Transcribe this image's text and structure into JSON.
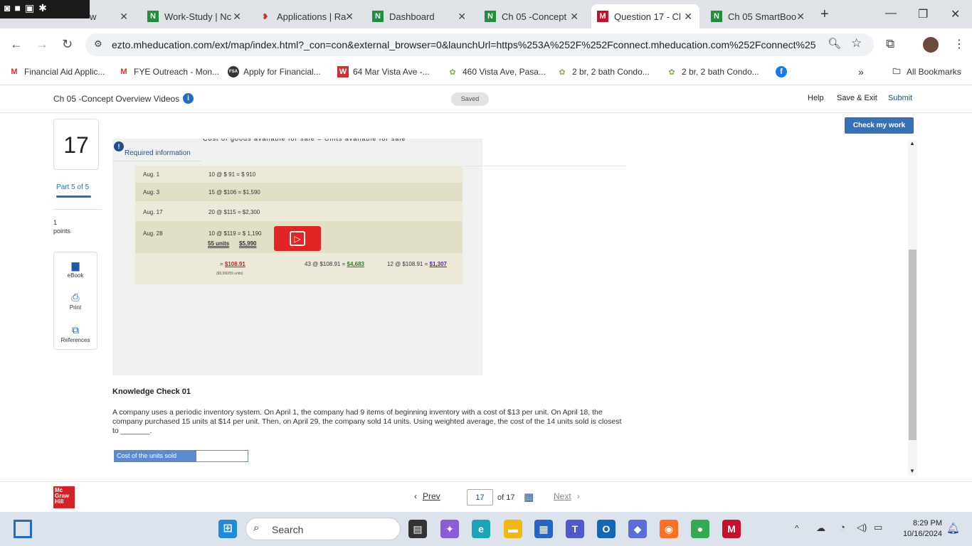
{
  "browser": {
    "tabs": [
      {
        "label": "w",
        "icon": "mixed-icon"
      },
      {
        "label": "Work-Study | Nc",
        "icon": "N"
      },
      {
        "label": "Applications | Ra",
        "icon": "R"
      },
      {
        "label": "Dashboard",
        "icon": "N"
      },
      {
        "label": "Ch 05 -Concept",
        "icon": "N"
      },
      {
        "label": "Question 17 - Cl",
        "icon": "M"
      },
      {
        "label": "Ch 05 SmartBoo",
        "icon": "N"
      }
    ],
    "new_tab": "+",
    "url": "ezto.mheducation.com/ext/map/index.html?_con=con&external_browser=0&launchUrl=https%253A%252F%252Fconnect.mheducation.com%252Fconnect%25...",
    "bookmarks": [
      {
        "label": "Financial Aid Applic...",
        "icon": "M"
      },
      {
        "label": "FYE Outreach - Mon...",
        "icon": "M"
      },
      {
        "label": "Apply for Financial...",
        "icon": "FSA"
      },
      {
        "label": "64 Mar Vista Ave -...",
        "icon": "W"
      },
      {
        "label": "460 Vista Ave, Pasa...",
        "icon": "✿"
      },
      {
        "label": "2 br, 2 bath Condo...",
        "icon": "✿"
      },
      {
        "label": "2 br, 2 bath Condo...",
        "icon": "✿"
      }
    ],
    "more_bookmarks": "»",
    "all_bookmarks": "All Bookmarks"
  },
  "app": {
    "title": "Ch 05 -Concept Overview Videos",
    "info": "i",
    "saved": "Saved",
    "help": "Help",
    "save_exit": "Save & Exit",
    "submit": "Submit",
    "check_work": "Check my work"
  },
  "sidebar": {
    "question_number": "17",
    "part": "Part 5 of 5",
    "points_value": "1",
    "points_label": "points",
    "tools": [
      {
        "label": "eBook",
        "icon": "book-icon"
      },
      {
        "label": "Print",
        "icon": "print-icon"
      },
      {
        "label": "References",
        "icon": "references-icon"
      }
    ]
  },
  "video": {
    "cutoff_heading": "Cost of goods available for sale  =  Units available for sale",
    "required_badge": "!",
    "required_info": "Required information",
    "rows": [
      {
        "date": "Aug. 1",
        "value": "10 @ $  91 = $   910"
      },
      {
        "date": "Aug. 3",
        "value": "15 @ $106 = $1,590"
      },
      {
        "date": "Aug. 17",
        "value": "20 @ $115 = $2,300"
      },
      {
        "date": "Aug. 28",
        "value": "10 @ $119 = $ 1,190"
      }
    ],
    "total_units": "55 units",
    "total_cost": "$5,990",
    "avg_prefix": "= ",
    "avg_cost": "$108.91",
    "avg_note": "($5,990/55 units)",
    "cogs_prefix": "43 @ $108.91 = ",
    "cogs_value": "$4,683",
    "ending_prefix": "12 @ $108.91 = ",
    "ending_value": "$1,307",
    "colors": {
      "red": "#c0252a",
      "green": "#2e7d32",
      "purple": "#5b2a86"
    }
  },
  "question": {
    "title": "Knowledge Check 01",
    "text": "A company uses a periodic inventory system. On April 1, the company had 9 items of beginning inventory with a cost of $13 per unit. On April 18, the company purchased 15 units at $14 per unit. Then, on April 29, the company sold 14 units. Using weighted average, the cost of the 14 units sold is closest to _______.",
    "answer_label": "Cost of the units sold",
    "answer_value": ""
  },
  "footer": {
    "logo": "Mc Graw Hill",
    "prev": "Prev",
    "page": "17",
    "of": "of  17",
    "next": "Next"
  },
  "taskbar": {
    "search": "Search",
    "time": "8:29 PM",
    "date": "10/16/2024"
  }
}
